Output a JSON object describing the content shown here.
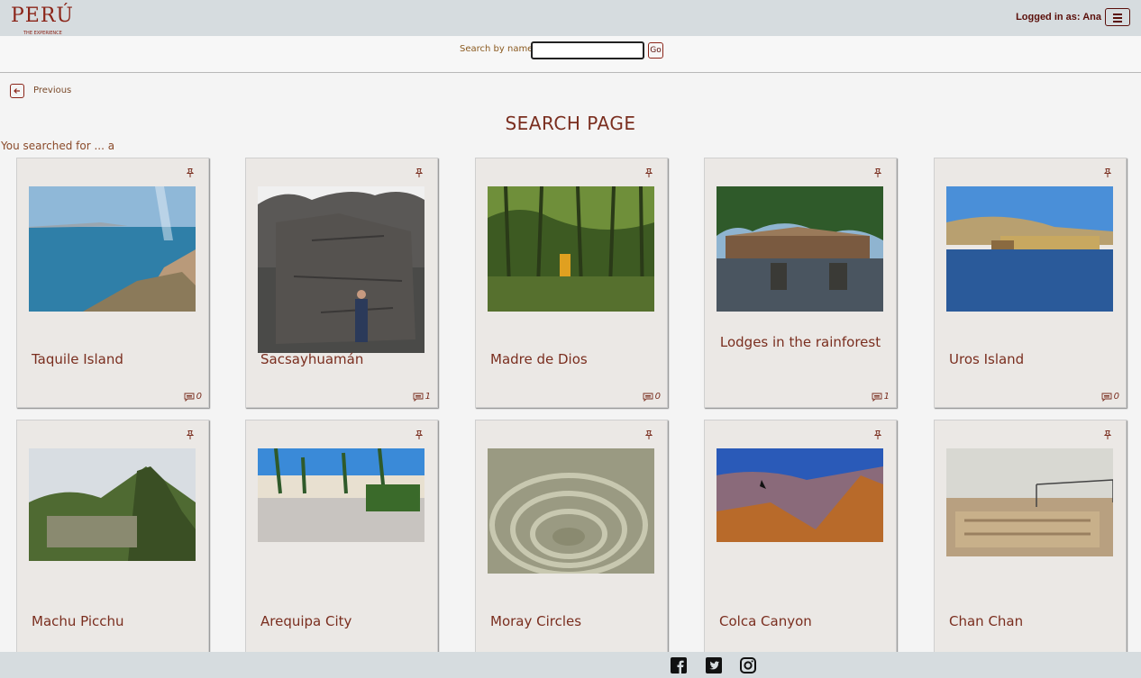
{
  "header": {
    "logo_text": "PERÚ",
    "logo_sub": "THE EXPERIENCE",
    "login_text": "Logged in as: Ana"
  },
  "search": {
    "label": "Search by name",
    "value": "",
    "placeholder": "",
    "go_label": "Go"
  },
  "nav": {
    "previous_label": "Previous"
  },
  "page": {
    "title": "SEARCH PAGE",
    "searched_text": "You searched for ... a"
  },
  "cards": [
    {
      "name": "Taquile Island",
      "comments": "0"
    },
    {
      "name": "Sacsayhuamán",
      "comments": "1"
    },
    {
      "name": "Madre de Dios",
      "comments": "0"
    },
    {
      "name": "Lodges in the rainforest",
      "comments": "1"
    },
    {
      "name": "Uros Island",
      "comments": "0"
    },
    {
      "name": "Machu Picchu",
      "comments": ""
    },
    {
      "name": "Arequipa City",
      "comments": ""
    },
    {
      "name": "Moray Circles",
      "comments": ""
    },
    {
      "name": "Colca Canyon",
      "comments": ""
    },
    {
      "name": "Chan Chan",
      "comments": ""
    }
  ],
  "footer": {
    "icons": [
      "facebook-icon",
      "twitter-icon",
      "instagram-icon"
    ]
  },
  "colors": {
    "accent": "#7a2e1f",
    "header_bg": "#d6dcdf",
    "card_bg": "#ebe8e5"
  }
}
